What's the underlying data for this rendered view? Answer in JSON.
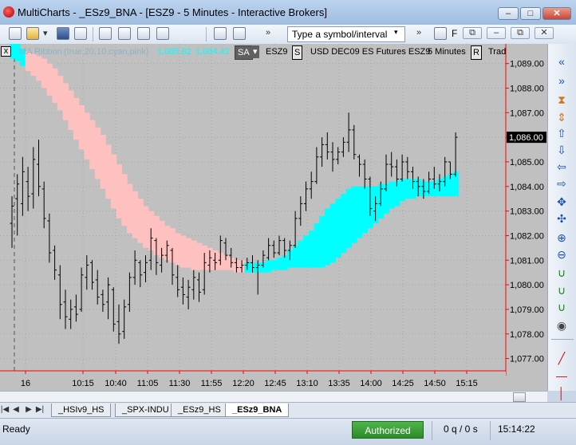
{
  "window": {
    "title": "MultiCharts - _ESz9_BNA - [ESZ9 - 5 Minutes - Interactive Brokers]",
    "min_glyph": "–",
    "max_glyph": "□",
    "close_glyph": "✕"
  },
  "toolbar": {
    "symbol_placeholder": "Type a symbol/interval",
    "more_glyph": "»",
    "mdi_restore": "⧉",
    "mdi_min": "–",
    "mdi_max": "⧉",
    "mdi_close": "✕"
  },
  "chart": {
    "legend": {
      "close": "x",
      "study_name": "MA Ribbon",
      "study_params": "(true,20,10,cyan,pink)",
      "value1": "1,085.82",
      "value2": "1,084.42",
      "sa_label": "SA",
      "dropdown_glyph": "▾",
      "symbol": "ESZ9",
      "s_box": "S",
      "description": "USD DEC09 ES Futures ESZ9",
      "interval": "5 Minutes",
      "r_box": "R",
      "trailing": "Trad"
    },
    "current_price_label": "1,086.00",
    "colors": {
      "background": "#c0c0c0",
      "bull_band": "#00ffff",
      "bear_band": "#ffc0c0",
      "bars": "#000000",
      "axis_line": "#ff0000",
      "current_price_bg": "#000000"
    }
  },
  "chart_data": {
    "type": "ohlc",
    "price_ticks": [
      "1,089.00",
      "1,088.00",
      "1,087.00",
      "1,086.00",
      "1,085.00",
      "1,084.00",
      "1,083.00",
      "1,082.00",
      "1,081.00",
      "1,080.00",
      "1,079.00",
      "1,078.00",
      "1,077.00"
    ],
    "price_tick_values": [
      1089,
      1088,
      1087,
      1086,
      1085,
      1084,
      1083,
      1082,
      1081,
      1080,
      1079,
      1078,
      1077
    ],
    "time_ticks": [
      "16",
      "10:15",
      "10:40",
      "11:05",
      "11:30",
      "11:55",
      "12:20",
      "12:45",
      "13:10",
      "13:35",
      "14:00",
      "14:25",
      "14:50",
      "15:15"
    ],
    "ylim": [
      1076.5,
      1089.8
    ],
    "current_price": 1086.0,
    "bars": [
      {
        "h": 1083.6,
        "l": 1081.5,
        "o": 1082.5,
        "c": 1083.2
      },
      {
        "h": 1084.5,
        "l": 1082.0,
        "o": 1083.5,
        "c": 1084.1
      },
      {
        "h": 1085.2,
        "l": 1082.8,
        "o": 1083.3,
        "c": 1084.6
      },
      {
        "h": 1084.8,
        "l": 1083.0,
        "o": 1084.2,
        "c": 1083.6
      },
      {
        "h": 1085.6,
        "l": 1083.1,
        "o": 1083.7,
        "c": 1085.1
      },
      {
        "h": 1085.9,
        "l": 1083.6,
        "o": 1084.9,
        "c": 1084.0
      },
      {
        "h": 1084.2,
        "l": 1082.3,
        "o": 1083.9,
        "c": 1082.7
      },
      {
        "h": 1082.9,
        "l": 1080.9,
        "o": 1082.6,
        "c": 1081.3
      },
      {
        "h": 1081.6,
        "l": 1080.2,
        "o": 1081.4,
        "c": 1080.6
      },
      {
        "h": 1080.8,
        "l": 1078.6,
        "o": 1080.4,
        "c": 1079.2
      },
      {
        "h": 1079.8,
        "l": 1078.2,
        "o": 1079.3,
        "c": 1078.7
      },
      {
        "h": 1079.4,
        "l": 1078.2,
        "o": 1078.6,
        "c": 1079.0
      },
      {
        "h": 1079.6,
        "l": 1078.5,
        "o": 1079.1,
        "c": 1078.8
      },
      {
        "h": 1080.7,
        "l": 1078.9,
        "o": 1079.0,
        "c": 1080.4
      },
      {
        "h": 1081.2,
        "l": 1079.8,
        "o": 1080.3,
        "c": 1080.8
      },
      {
        "h": 1081.0,
        "l": 1079.8,
        "o": 1080.9,
        "c": 1080.1
      },
      {
        "h": 1080.6,
        "l": 1079.2,
        "o": 1080.2,
        "c": 1079.5
      },
      {
        "h": 1079.8,
        "l": 1078.9,
        "o": 1079.6,
        "c": 1079.2
      },
      {
        "h": 1080.3,
        "l": 1078.6,
        "o": 1079.3,
        "c": 1080.0
      },
      {
        "h": 1079.9,
        "l": 1078.1,
        "o": 1079.8,
        "c": 1078.4
      },
      {
        "h": 1079.2,
        "l": 1077.6,
        "o": 1078.5,
        "c": 1078.0
      },
      {
        "h": 1079.4,
        "l": 1077.8,
        "o": 1078.1,
        "c": 1079.1
      },
      {
        "h": 1080.5,
        "l": 1078.9,
        "o": 1079.2,
        "c": 1080.3
      },
      {
        "h": 1081.4,
        "l": 1080.0,
        "o": 1080.3,
        "c": 1081.0
      },
      {
        "h": 1081.0,
        "l": 1079.9,
        "o": 1080.9,
        "c": 1080.4
      },
      {
        "h": 1081.2,
        "l": 1080.1,
        "o": 1080.5,
        "c": 1080.9
      },
      {
        "h": 1082.3,
        "l": 1080.6,
        "o": 1081.0,
        "c": 1081.9
      },
      {
        "h": 1081.9,
        "l": 1080.4,
        "o": 1081.8,
        "c": 1080.9
      },
      {
        "h": 1081.5,
        "l": 1080.5,
        "o": 1080.8,
        "c": 1081.2
      },
      {
        "h": 1081.8,
        "l": 1080.9,
        "o": 1081.2,
        "c": 1081.6
      },
      {
        "h": 1081.5,
        "l": 1080.0,
        "o": 1081.4,
        "c": 1080.4
      },
      {
        "h": 1080.8,
        "l": 1079.5,
        "o": 1080.3,
        "c": 1079.8
      },
      {
        "h": 1080.3,
        "l": 1079.2,
        "o": 1079.9,
        "c": 1079.6
      },
      {
        "h": 1080.2,
        "l": 1079.0,
        "o": 1079.5,
        "c": 1079.9
      },
      {
        "h": 1080.6,
        "l": 1079.4,
        "o": 1079.8,
        "c": 1080.3
      },
      {
        "h": 1080.5,
        "l": 1079.3,
        "o": 1080.2,
        "c": 1079.7
      },
      {
        "h": 1081.3,
        "l": 1079.6,
        "o": 1079.8,
        "c": 1080.9
      },
      {
        "h": 1081.4,
        "l": 1080.5,
        "o": 1080.8,
        "c": 1081.1
      },
      {
        "h": 1081.3,
        "l": 1080.6,
        "o": 1081.0,
        "c": 1080.9
      },
      {
        "h": 1082.0,
        "l": 1080.8,
        "o": 1081.0,
        "c": 1081.8
      },
      {
        "h": 1081.9,
        "l": 1081.0,
        "o": 1081.7,
        "c": 1081.2
      },
      {
        "h": 1081.5,
        "l": 1080.7,
        "o": 1081.2,
        "c": 1080.9
      },
      {
        "h": 1081.1,
        "l": 1080.5,
        "o": 1080.9,
        "c": 1080.7
      },
      {
        "h": 1081.0,
        "l": 1080.5,
        "o": 1080.7,
        "c": 1080.8
      },
      {
        "h": 1081.1,
        "l": 1080.6,
        "o": 1080.8,
        "c": 1080.9
      },
      {
        "h": 1081.2,
        "l": 1080.5,
        "o": 1080.9,
        "c": 1080.7
      },
      {
        "h": 1081.0,
        "l": 1079.6,
        "o": 1080.7,
        "c": 1080.8
      },
      {
        "h": 1081.4,
        "l": 1080.7,
        "o": 1080.8,
        "c": 1081.2
      },
      {
        "h": 1081.9,
        "l": 1081.0,
        "o": 1081.1,
        "c": 1081.6
      },
      {
        "h": 1081.8,
        "l": 1081.1,
        "o": 1081.6,
        "c": 1081.3
      },
      {
        "h": 1082.0,
        "l": 1081.2,
        "o": 1081.3,
        "c": 1081.8
      },
      {
        "h": 1081.9,
        "l": 1081.1,
        "o": 1081.8,
        "c": 1081.4
      },
      {
        "h": 1081.8,
        "l": 1081.0,
        "o": 1081.4,
        "c": 1081.6
      },
      {
        "h": 1083.0,
        "l": 1081.5,
        "o": 1081.6,
        "c": 1082.7
      },
      {
        "h": 1083.6,
        "l": 1082.4,
        "o": 1082.7,
        "c": 1083.3
      },
      {
        "h": 1084.2,
        "l": 1083.0,
        "o": 1083.3,
        "c": 1083.9
      },
      {
        "h": 1084.6,
        "l": 1083.5,
        "o": 1083.9,
        "c": 1084.2
      },
      {
        "h": 1085.6,
        "l": 1084.1,
        "o": 1084.2,
        "c": 1085.2
      },
      {
        "h": 1086.0,
        "l": 1084.8,
        "o": 1085.2,
        "c": 1085.7
      },
      {
        "h": 1086.2,
        "l": 1085.1,
        "o": 1085.7,
        "c": 1085.4
      },
      {
        "h": 1085.8,
        "l": 1084.6,
        "o": 1085.4,
        "c": 1085.1
      },
      {
        "h": 1085.6,
        "l": 1084.9,
        "o": 1085.1,
        "c": 1085.4
      },
      {
        "h": 1086.0,
        "l": 1085.2,
        "o": 1085.4,
        "c": 1085.8
      },
      {
        "h": 1087.0,
        "l": 1085.4,
        "o": 1085.8,
        "c": 1086.3
      },
      {
        "h": 1086.5,
        "l": 1085.1,
        "o": 1086.3,
        "c": 1085.3
      },
      {
        "h": 1085.3,
        "l": 1084.4,
        "o": 1085.2,
        "c": 1084.9
      },
      {
        "h": 1085.1,
        "l": 1083.9,
        "o": 1084.9,
        "c": 1084.3
      },
      {
        "h": 1084.4,
        "l": 1082.8,
        "o": 1084.3,
        "c": 1083.1
      },
      {
        "h": 1083.6,
        "l": 1082.6,
        "o": 1083.0,
        "c": 1083.3
      },
      {
        "h": 1084.2,
        "l": 1083.2,
        "o": 1083.3,
        "c": 1083.9
      },
      {
        "h": 1085.3,
        "l": 1083.8,
        "o": 1083.9,
        "c": 1084.9
      },
      {
        "h": 1085.4,
        "l": 1084.4,
        "o": 1084.9,
        "c": 1084.8
      },
      {
        "h": 1085.1,
        "l": 1084.0,
        "o": 1084.8,
        "c": 1084.3
      },
      {
        "h": 1085.3,
        "l": 1084.2,
        "o": 1084.3,
        "c": 1085.0
      },
      {
        "h": 1085.2,
        "l": 1084.3,
        "o": 1085.0,
        "c": 1084.6
      },
      {
        "h": 1084.8,
        "l": 1083.9,
        "o": 1084.6,
        "c": 1084.2
      },
      {
        "h": 1084.4,
        "l": 1083.6,
        "o": 1084.2,
        "c": 1084.0
      },
      {
        "h": 1084.3,
        "l": 1083.5,
        "o": 1084.0,
        "c": 1083.8
      },
      {
        "h": 1084.6,
        "l": 1083.7,
        "o": 1083.8,
        "c": 1084.3
      },
      {
        "h": 1084.8,
        "l": 1083.9,
        "o": 1084.3,
        "c": 1084.1
      },
      {
        "h": 1084.5,
        "l": 1083.8,
        "o": 1084.1,
        "c": 1084.2
      },
      {
        "h": 1085.2,
        "l": 1084.0,
        "o": 1084.2,
        "c": 1085.0
      },
      {
        "h": 1085.0,
        "l": 1084.3,
        "o": 1085.0,
        "c": 1084.5
      },
      {
        "h": 1086.2,
        "l": 1084.4,
        "o": 1084.5,
        "c": 1086.0
      }
    ],
    "ribbon": [
      {
        "u": 1089.8,
        "l": 1089.2,
        "s": "bull"
      },
      {
        "u": 1089.8,
        "l": 1089.1,
        "s": "bull"
      },
      {
        "u": 1089.6,
        "l": 1088.9,
        "s": "bull"
      },
      {
        "u": 1089.5,
        "l": 1088.7,
        "s": "bear"
      },
      {
        "u": 1089.4,
        "l": 1088.5,
        "s": "bear"
      },
      {
        "u": 1089.3,
        "l": 1088.3,
        "s": "bear"
      },
      {
        "u": 1089.2,
        "l": 1088.0,
        "s": "bear"
      },
      {
        "u": 1089.0,
        "l": 1087.7,
        "s": "bear"
      },
      {
        "u": 1088.8,
        "l": 1087.4,
        "s": "bear"
      },
      {
        "u": 1088.5,
        "l": 1087.1,
        "s": "bear"
      },
      {
        "u": 1088.2,
        "l": 1086.7,
        "s": "bear"
      },
      {
        "u": 1087.9,
        "l": 1086.3,
        "s": "bear"
      },
      {
        "u": 1087.6,
        "l": 1085.9,
        "s": "bear"
      },
      {
        "u": 1087.3,
        "l": 1085.5,
        "s": "bear"
      },
      {
        "u": 1087.0,
        "l": 1085.1,
        "s": "bear"
      },
      {
        "u": 1086.7,
        "l": 1084.7,
        "s": "bear"
      },
      {
        "u": 1086.4,
        "l": 1084.3,
        "s": "bear"
      },
      {
        "u": 1086.1,
        "l": 1083.9,
        "s": "bear"
      },
      {
        "u": 1085.7,
        "l": 1083.5,
        "s": "bear"
      },
      {
        "u": 1085.3,
        "l": 1083.1,
        "s": "bear"
      },
      {
        "u": 1084.9,
        "l": 1082.7,
        "s": "bear"
      },
      {
        "u": 1084.5,
        "l": 1082.4,
        "s": "bear"
      },
      {
        "u": 1084.1,
        "l": 1082.1,
        "s": "bear"
      },
      {
        "u": 1083.8,
        "l": 1081.9,
        "s": "bear"
      },
      {
        "u": 1083.5,
        "l": 1081.7,
        "s": "bear"
      },
      {
        "u": 1083.2,
        "l": 1081.5,
        "s": "bear"
      },
      {
        "u": 1083.0,
        "l": 1081.4,
        "s": "bear"
      },
      {
        "u": 1082.8,
        "l": 1081.2,
        "s": "bear"
      },
      {
        "u": 1082.6,
        "l": 1081.1,
        "s": "bear"
      },
      {
        "u": 1082.4,
        "l": 1081.0,
        "s": "bear"
      },
      {
        "u": 1082.3,
        "l": 1080.9,
        "s": "bear"
      },
      {
        "u": 1082.1,
        "l": 1080.8,
        "s": "bear"
      },
      {
        "u": 1082.0,
        "l": 1080.7,
        "s": "bear"
      },
      {
        "u": 1081.9,
        "l": 1080.7,
        "s": "bear"
      },
      {
        "u": 1081.8,
        "l": 1080.6,
        "s": "bear"
      },
      {
        "u": 1081.7,
        "l": 1080.6,
        "s": "bear"
      },
      {
        "u": 1081.6,
        "l": 1080.6,
        "s": "bear"
      },
      {
        "u": 1081.5,
        "l": 1080.6,
        "s": "bear"
      },
      {
        "u": 1081.4,
        "l": 1080.6,
        "s": "bear"
      },
      {
        "u": 1081.3,
        "l": 1080.6,
        "s": "bear"
      },
      {
        "u": 1081.2,
        "l": 1080.6,
        "s": "bear"
      },
      {
        "u": 1081.1,
        "l": 1080.6,
        "s": "bear"
      },
      {
        "u": 1081.0,
        "l": 1080.5,
        "s": "bear"
      },
      {
        "u": 1081.0,
        "l": 1080.5,
        "s": "bear"
      },
      {
        "u": 1080.9,
        "l": 1080.5,
        "s": "bull"
      },
      {
        "u": 1080.9,
        "l": 1080.5,
        "s": "bull"
      },
      {
        "u": 1080.9,
        "l": 1080.5,
        "s": "bull"
      },
      {
        "u": 1080.9,
        "l": 1080.5,
        "s": "bull"
      },
      {
        "u": 1081.0,
        "l": 1080.5,
        "s": "bull"
      },
      {
        "u": 1081.0,
        "l": 1080.6,
        "s": "bull"
      },
      {
        "u": 1081.1,
        "l": 1080.6,
        "s": "bull"
      },
      {
        "u": 1081.2,
        "l": 1080.6,
        "s": "bull"
      },
      {
        "u": 1081.4,
        "l": 1080.7,
        "s": "bull"
      },
      {
        "u": 1081.6,
        "l": 1080.7,
        "s": "bull"
      },
      {
        "u": 1081.8,
        "l": 1080.7,
        "s": "bull"
      },
      {
        "u": 1082.0,
        "l": 1080.7,
        "s": "bull"
      },
      {
        "u": 1082.2,
        "l": 1080.7,
        "s": "bull"
      },
      {
        "u": 1082.5,
        "l": 1080.7,
        "s": "bull"
      },
      {
        "u": 1082.8,
        "l": 1080.7,
        "s": "bull"
      },
      {
        "u": 1083.1,
        "l": 1080.8,
        "s": "bull"
      },
      {
        "u": 1083.3,
        "l": 1080.9,
        "s": "bull"
      },
      {
        "u": 1083.5,
        "l": 1081.1,
        "s": "bull"
      },
      {
        "u": 1083.7,
        "l": 1081.3,
        "s": "bull"
      },
      {
        "u": 1083.9,
        "l": 1081.5,
        "s": "bull"
      },
      {
        "u": 1084.0,
        "l": 1081.7,
        "s": "bull"
      },
      {
        "u": 1084.0,
        "l": 1081.9,
        "s": "bull"
      },
      {
        "u": 1084.0,
        "l": 1082.1,
        "s": "bull"
      },
      {
        "u": 1084.0,
        "l": 1082.3,
        "s": "bull"
      },
      {
        "u": 1084.0,
        "l": 1082.5,
        "s": "bull"
      },
      {
        "u": 1084.1,
        "l": 1082.7,
        "s": "bull"
      },
      {
        "u": 1084.1,
        "l": 1082.9,
        "s": "bull"
      },
      {
        "u": 1084.2,
        "l": 1083.1,
        "s": "bull"
      },
      {
        "u": 1084.2,
        "l": 1083.2,
        "s": "bull"
      },
      {
        "u": 1084.3,
        "l": 1083.4,
        "s": "bull"
      },
      {
        "u": 1084.3,
        "l": 1083.5,
        "s": "bull"
      },
      {
        "u": 1084.3,
        "l": 1083.5,
        "s": "bull"
      },
      {
        "u": 1084.3,
        "l": 1083.6,
        "s": "bull"
      },
      {
        "u": 1084.2,
        "l": 1083.6,
        "s": "bull"
      },
      {
        "u": 1084.2,
        "l": 1083.6,
        "s": "bull"
      },
      {
        "u": 1084.2,
        "l": 1083.6,
        "s": "bull"
      },
      {
        "u": 1084.3,
        "l": 1083.6,
        "s": "bull"
      },
      {
        "u": 1084.4,
        "l": 1083.6,
        "s": "bull"
      },
      {
        "u": 1084.5,
        "l": 1083.6,
        "s": "bull"
      },
      {
        "u": 1084.6,
        "l": 1083.6,
        "s": "bull"
      }
    ]
  },
  "sidebar": {
    "tools": [
      {
        "icon": "scroll-left-end-icon",
        "glyph": "«",
        "color": "#1a4fb5"
      },
      {
        "icon": "scroll-right-end-icon",
        "glyph": "»",
        "color": "#1a4fb5"
      },
      {
        "icon": "hourglass-icon",
        "glyph": "⧗",
        "color": "#d4741c"
      },
      {
        "icon": "expand-vertical-icon",
        "glyph": "⇕",
        "color": "#d4741c"
      },
      {
        "icon": "arrow-up-icon",
        "glyph": "⇧",
        "color": "#1a4fb5"
      },
      {
        "icon": "arrow-down-icon",
        "glyph": "⇩",
        "color": "#1a4fb5"
      },
      {
        "icon": "arrow-left-icon",
        "glyph": "⇦",
        "color": "#1a4fb5"
      },
      {
        "icon": "arrow-right-icon",
        "glyph": "⇨",
        "color": "#1a4fb5"
      },
      {
        "icon": "compress-icon",
        "glyph": "✥",
        "color": "#1a4fb5"
      },
      {
        "icon": "expand-icon",
        "glyph": "✣",
        "color": "#1a4fb5"
      },
      {
        "icon": "zoom-in-icon",
        "glyph": "⊕",
        "color": "#1a4fb5"
      },
      {
        "icon": "zoom-out-icon",
        "glyph": "⊖",
        "color": "#1a4fb5"
      },
      {
        "icon": "magnet-icon",
        "glyph": "∪",
        "color": "#1a8a1a"
      },
      {
        "icon": "magnet-plus-icon",
        "glyph": "∪",
        "color": "#1a8a1a"
      },
      {
        "icon": "magnet-close-icon",
        "glyph": "∪",
        "color": "#1a8a1a"
      },
      {
        "icon": "eye-icon",
        "glyph": "◉",
        "color": "#444444"
      },
      {
        "icon": "trendline-icon",
        "glyph": "╱",
        "color": "#cc1111"
      },
      {
        "icon": "horizontal-line-icon",
        "glyph": "—",
        "color": "#cc1111"
      },
      {
        "icon": "vertical-line-icon",
        "glyph": "│",
        "color": "#cc1111"
      }
    ]
  },
  "tabs": {
    "nav": [
      "|◀",
      "◀",
      "▶",
      "▶|"
    ],
    "items": [
      {
        "label": "_HSIv9_HS",
        "active": false
      },
      {
        "label": "_SPX-INDU",
        "active": false
      },
      {
        "label": "_ESz9_HS",
        "active": false
      },
      {
        "label": "_ESz9_BNA",
        "active": true
      }
    ]
  },
  "status": {
    "ready": "Ready",
    "authorized": "Authorized",
    "queue": "0 q / 0 s",
    "time": "15:14:22"
  }
}
